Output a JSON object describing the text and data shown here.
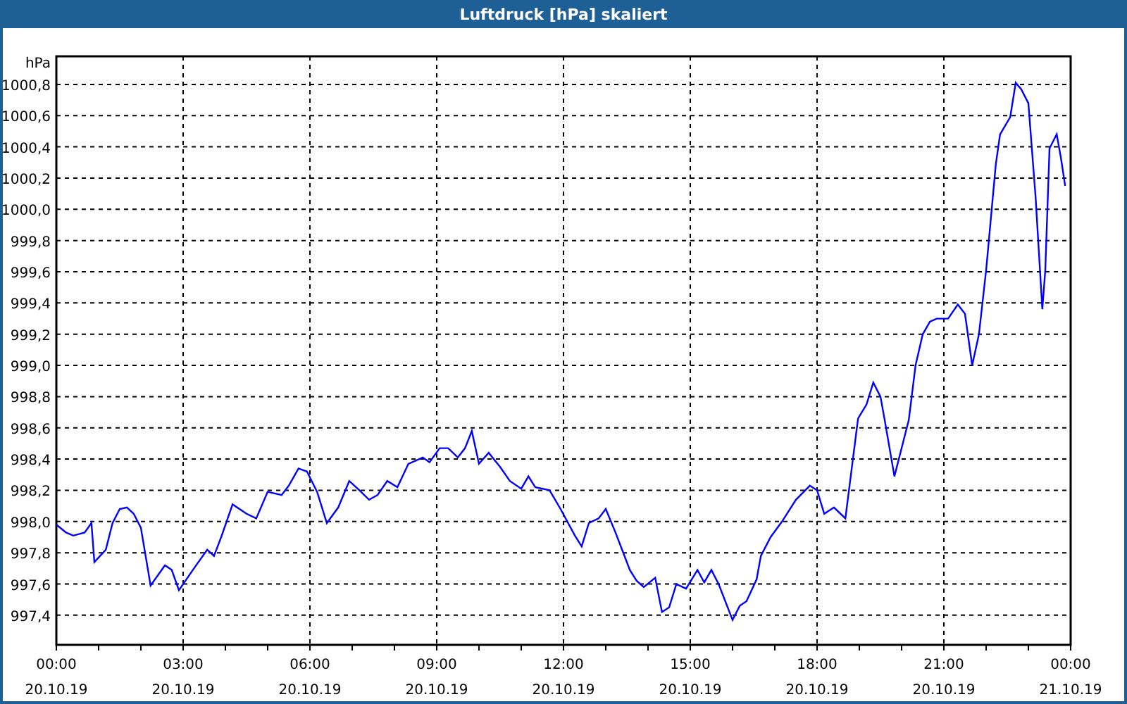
{
  "window": {
    "title": "Luftdruck [hPa] skaliert"
  },
  "chart": {
    "tick_dates": [
      "20.10.19",
      "20.10.19",
      "20.10.19",
      "20.10.19",
      "20.10.19",
      "20.10.19",
      "20.10.19",
      "20.10.19",
      "21.10.19"
    ],
    "chart_data": {
      "type": "line",
      "ylabel": "hPa",
      "x": [
        0,
        0.23,
        0.4,
        0.67,
        0.83,
        0.9,
        1.17,
        1.33,
        1.5,
        1.67,
        1.83,
        2,
        2.23,
        2.57,
        2.73,
        2.9,
        3.23,
        3.57,
        3.73,
        3.9,
        4.17,
        4.5,
        4.73,
        5,
        5.33,
        5.5,
        5.73,
        5.93,
        6.17,
        6.4,
        6.67,
        6.93,
        7.17,
        7.4,
        7.6,
        7.83,
        8.07,
        8.33,
        8.67,
        8.83,
        9.07,
        9.27,
        9.5,
        9.67,
        9.83,
        10,
        10.23,
        10.5,
        10.73,
        11,
        11.17,
        11.33,
        11.67,
        11.93,
        12.27,
        12.43,
        12.6,
        12.83,
        13,
        13.23,
        13.4,
        13.57,
        13.73,
        13.9,
        14.17,
        14.33,
        14.5,
        14.67,
        14.9,
        15.17,
        15.33,
        15.5,
        15.67,
        16,
        16.17,
        16.33,
        16.57,
        16.67,
        16.9,
        17.17,
        17.5,
        17.83,
        18,
        18.17,
        18.4,
        18.67,
        18.97,
        19.17,
        19.33,
        19.5,
        19.6,
        19.83,
        20.17,
        20.33,
        20.5,
        20.67,
        20.83,
        21.1,
        21.33,
        21.5,
        21.67,
        21.83,
        22,
        22.23,
        22.33,
        22.57,
        22.7,
        22.83,
        23,
        23.17,
        23.33,
        23.4,
        23.5,
        23.67,
        23.77,
        23.87
      ],
      "series": [
        {
          "color": "#0000ff",
          "values": [
            997.98,
            997.93,
            997.91,
            997.93,
            997.99,
            997.74,
            997.82,
            997.99,
            998.08,
            998.09,
            998.05,
            997.96,
            997.59,
            997.72,
            997.69,
            997.56,
            997.69,
            997.82,
            997.78,
            997.9,
            998.11,
            998.05,
            998.02,
            998.19,
            998.17,
            998.23,
            998.34,
            998.32,
            998.19,
            997.99,
            998.09,
            998.26,
            998.2,
            998.14,
            998.17,
            998.26,
            998.22,
            998.37,
            998.41,
            998.38,
            998.47,
            998.47,
            998.41,
            998.47,
            998.58,
            998.37,
            998.44,
            998.35,
            998.26,
            998.21,
            998.29,
            998.22,
            998.2,
            998.08,
            997.91,
            997.84,
            997.99,
            998.02,
            998.08,
            997.93,
            997.81,
            997.69,
            997.62,
            997.58,
            997.64,
            997.42,
            997.45,
            997.6,
            997.57,
            997.69,
            997.61,
            997.69,
            997.6,
            997.37,
            997.46,
            997.49,
            997.63,
            997.78,
            997.9,
            998,
            998.14,
            998.23,
            998.2,
            998.05,
            998.09,
            998.02,
            998.66,
            998.75,
            998.89,
            998.8,
            998.65,
            998.29,
            998.65,
            999,
            999.2,
            999.28,
            999.3,
            999.3,
            999.39,
            999.33,
            999,
            999.2,
            999.61,
            1000.29,
            1000.48,
            1000.59,
            1000.81,
            1000.77,
            1000.68,
            1000.08,
            999.36,
            999.61,
            1000.39,
            1000.48,
            1000.33,
            1000.15
          ]
        }
      ],
      "xlim": [
        0,
        24
      ],
      "grid": true,
      "ylim": [
        997.21,
        1000.98
      ],
      "xticks": [
        {
          "value": 0,
          "label": "00:00"
        },
        {
          "value": 3,
          "label": "03:00"
        },
        {
          "value": 6,
          "label": "06:00"
        },
        {
          "value": 9,
          "label": "09:00"
        },
        {
          "value": 12,
          "label": "12:00"
        },
        {
          "value": 15,
          "label": "15:00"
        },
        {
          "value": 18,
          "label": "18:00"
        },
        {
          "value": 21,
          "label": "21:00"
        },
        {
          "value": 24,
          "label": "00:00"
        }
      ],
      "yticks": [
        {
          "value": 997.4,
          "label": "997,4"
        },
        {
          "value": 997.6,
          "label": "997,6"
        },
        {
          "value": 997.8,
          "label": "997,8"
        },
        {
          "value": 998,
          "label": "998,0"
        },
        {
          "value": 998.2,
          "label": "998,2"
        },
        {
          "value": 998.4,
          "label": "998,4"
        },
        {
          "value": 998.6,
          "label": "998,6"
        },
        {
          "value": 998.8,
          "label": "998,8"
        },
        {
          "value": 999,
          "label": "999,0"
        },
        {
          "value": 999.2,
          "label": "999,2"
        },
        {
          "value": 999.4,
          "label": "999,4"
        },
        {
          "value": 999.6,
          "label": "999,6"
        },
        {
          "value": 999.8,
          "label": "999,8"
        },
        {
          "value": 1000,
          "label": "1000,0"
        },
        {
          "value": 1000.2,
          "label": "1000,2"
        },
        {
          "value": 1000.4,
          "label": "1000,4"
        },
        {
          "value": 1000.6,
          "label": "1000,6"
        },
        {
          "value": 1000.8,
          "label": "1000,8"
        }
      ]
    }
  }
}
